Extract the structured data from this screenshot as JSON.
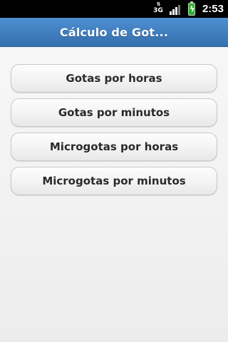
{
  "status_bar": {
    "network_label": "3G",
    "time": "2:53",
    "icons": [
      "network-3g-icon",
      "signal-icon",
      "battery-charging-icon"
    ]
  },
  "title_bar": {
    "title": "Cálculo de Got..."
  },
  "menu": {
    "items": [
      {
        "label": "Gotas por horas"
      },
      {
        "label": "Gotas por minutos"
      },
      {
        "label": "Microgotas por horas"
      },
      {
        "label": "Microgotas por minutos"
      }
    ]
  },
  "colors": {
    "title_bar": "#3f7dbe",
    "background": "#f0f0f0",
    "button_text": "#2a2a2a",
    "battery": "#2bb52b"
  }
}
